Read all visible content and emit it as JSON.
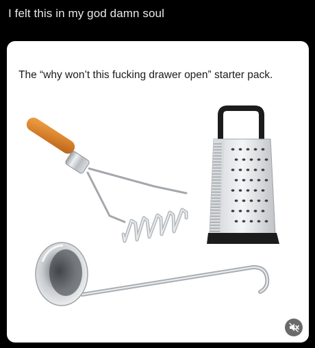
{
  "post": {
    "caption": "I felt this in my god damn soul"
  },
  "meme": {
    "headline": "The “why won’t this fucking drawer open” starter pack.",
    "items": [
      {
        "icon": "potato-masher-icon"
      },
      {
        "icon": "box-grater-icon"
      },
      {
        "icon": "ladle-icon"
      }
    ]
  },
  "controls": {
    "mute_icon": "volume-muted-icon"
  }
}
